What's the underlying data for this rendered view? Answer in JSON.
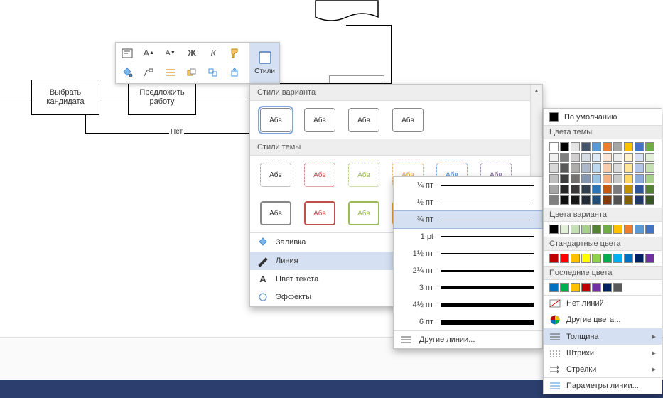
{
  "diagram": {
    "select_candidate": "Выбрать\nкандидата",
    "offer_job": "Предложить\nработу",
    "no_label": "Нет"
  },
  "toolbar": {
    "styles_label": "Стили",
    "btns": [
      "text-box",
      "font-grow",
      "font-shrink",
      "bold",
      "italic",
      "format-painter",
      "fill",
      "connector",
      "align",
      "arrange",
      "group",
      "rotate"
    ]
  },
  "styles_dropdown": {
    "section_variant": "Стили варианта",
    "section_theme": "Стили темы",
    "sample": "Абв",
    "menu_fill": "Заливка",
    "menu_line": "Линия",
    "menu_text_color": "Цвет текста",
    "menu_effects": "Эффекты"
  },
  "line_weights": {
    "items": [
      {
        "label": "¼ пт",
        "h": 0.5
      },
      {
        "label": "½ пт",
        "h": 1
      },
      {
        "label": "¾ пт",
        "h": 1
      },
      {
        "label": "1 pt",
        "h": 1.5
      },
      {
        "label": "1½ пт",
        "h": 2
      },
      {
        "label": "2¼ пт",
        "h": 3
      },
      {
        "label": "3 пт",
        "h": 4
      },
      {
        "label": "4½ пт",
        "h": 5.5
      },
      {
        "label": "6 пт",
        "h": 7
      }
    ],
    "more_lines": "Другие линии..."
  },
  "color_panel": {
    "default": "По умолчанию",
    "section_theme": "Цвета темы",
    "section_variant": "Цвета варианта",
    "section_standard": "Стандартные цвета",
    "section_recent": "Последние цвета",
    "no_lines": "Нет линий",
    "more_colors": "Другие цвета...",
    "weight": "Толщина",
    "dashes": "Штрихи",
    "arrows": "Стрелки",
    "line_options": "Параметры линии...",
    "theme_colors": [
      [
        "#ffffff",
        "#000000",
        "#e7e6e6",
        "#44546a",
        "#5b9bd5",
        "#ed7d31",
        "#a5a5a5",
        "#ffc000",
        "#4472c4",
        "#70ad47"
      ],
      [
        "#f2f2f2",
        "#7f7f7f",
        "#d0cece",
        "#d6dce4",
        "#deebf6",
        "#fbe5d5",
        "#ededed",
        "#fff2cc",
        "#d9e2f3",
        "#e2efd9"
      ],
      [
        "#d8d8d8",
        "#595959",
        "#aeabab",
        "#adb9ca",
        "#bdd7ee",
        "#f7cbac",
        "#dbdbdb",
        "#fee599",
        "#b4c6e7",
        "#c5e0b3"
      ],
      [
        "#bfbfbf",
        "#3f3f3f",
        "#757070",
        "#8496b0",
        "#9cc3e5",
        "#f4b183",
        "#c9c9c9",
        "#ffd965",
        "#8eaadb",
        "#a8d08d"
      ],
      [
        "#a5a5a5",
        "#262626",
        "#3a3838",
        "#323f4f",
        "#2e75b5",
        "#c55a11",
        "#7b7b7b",
        "#bf9000",
        "#2f5496",
        "#538135"
      ],
      [
        "#7f7f7f",
        "#0c0c0c",
        "#171616",
        "#222a35",
        "#1e4e79",
        "#833c0b",
        "#525252",
        "#7f6000",
        "#1f3864",
        "#375623"
      ]
    ],
    "variant_colors": [
      "#000000",
      "#e2efd9",
      "#c5e0b3",
      "#a8d08d",
      "#548235",
      "#70ad47",
      "#ffc000",
      "#ed7d31",
      "#5b9bd5",
      "#4472c4"
    ],
    "standard_colors": [
      "#c00000",
      "#ff0000",
      "#ffc000",
      "#ffff00",
      "#92d050",
      "#00b050",
      "#00b0f0",
      "#0070c0",
      "#002060",
      "#7030a0"
    ],
    "recent_colors": [
      "#0070c0",
      "#00b050",
      "#ffc000",
      "#c00000",
      "#7030a0",
      "#002060",
      "#595959"
    ]
  }
}
